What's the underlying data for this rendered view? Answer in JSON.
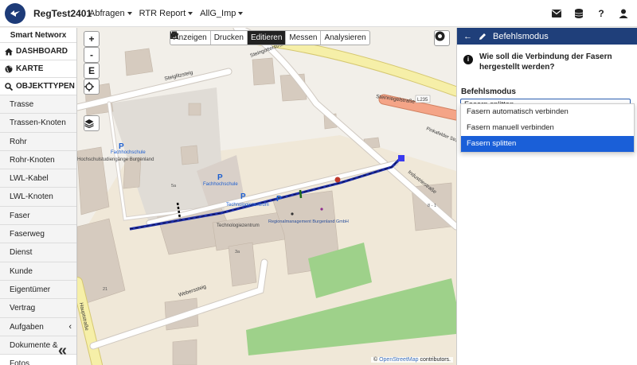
{
  "app": {
    "title": "RegTest2401"
  },
  "menu": [
    {
      "label": "Abfragen"
    },
    {
      "label": "RTR Report"
    },
    {
      "label": "AllG_Imp"
    }
  ],
  "sidebar": {
    "brand": "Smart Networx",
    "sections": [
      {
        "label": "DASHBOARD",
        "icon": "home-icon"
      },
      {
        "label": "KARTE",
        "icon": "globe-icon"
      },
      {
        "label": "OBJEKTTYPEN",
        "icon": "search-icon"
      }
    ],
    "items": [
      {
        "label": "Trasse"
      },
      {
        "label": "Trassen-Knoten"
      },
      {
        "label": "Rohr"
      },
      {
        "label": "Rohr-Knoten"
      },
      {
        "label": "LWL-Kabel"
      },
      {
        "label": "LWL-Knoten"
      },
      {
        "label": "Faser"
      },
      {
        "label": "Faserweg"
      },
      {
        "label": "Dienst"
      },
      {
        "label": "Kunde"
      },
      {
        "label": "Eigentümer"
      },
      {
        "label": "Vertrag"
      },
      {
        "label": "Aufgaben"
      },
      {
        "label": "Dokumente & Fotos"
      }
    ]
  },
  "toolbar": {
    "anzeigen": "Anzeigen",
    "drucken": "Drucken",
    "editieren": "Editieren",
    "messen": "Messen",
    "analysieren": "Analysieren"
  },
  "map_controls": {
    "zoom_in": "+",
    "zoom_out": "-",
    "e_button": "E"
  },
  "map_labels": {
    "street1": "Steingötterstraße",
    "street2": "Steiglitzsteig",
    "street3": "Steinriegelstraße",
    "road_ref": "L235",
    "street4": "Pinkafelder Straße",
    "street5": "Industriestraße",
    "street6": "Weberssteig",
    "street7": "Hauptstraße",
    "poi1": "Fachhochschule",
    "poi2": "Hochschulstudiengänge Burgenland",
    "poi3": "Fachhochschule",
    "poi4": "Technologiezentrum",
    "poi5": "Technologiezentrum",
    "poi6": "Regionalmanagement Burgenland GmbH",
    "num1": "5a",
    "num2": "3a",
    "num3": "21",
    "num4": "8 - 1",
    "park": "P"
  },
  "attribution": {
    "prefix": "©",
    "link": "OpenStreetMap",
    "suffix": "contributors."
  },
  "panel": {
    "title": "Befehlsmodus",
    "question": "Wie soll die Verbindung der Fasern hergestellt werden?",
    "label": "Befehlsmodus",
    "selected": "Fasern splitten",
    "options": [
      {
        "label": "Fasern automatisch verbinden",
        "selected": false
      },
      {
        "label": "Fasern manuell verbinden",
        "selected": false
      },
      {
        "label": "Fasern splitten",
        "selected": true
      }
    ]
  },
  "colors": {
    "header_blue": "#1f3f7a",
    "select_blue": "#1a5fd8",
    "cable": "#1e2fa8"
  }
}
